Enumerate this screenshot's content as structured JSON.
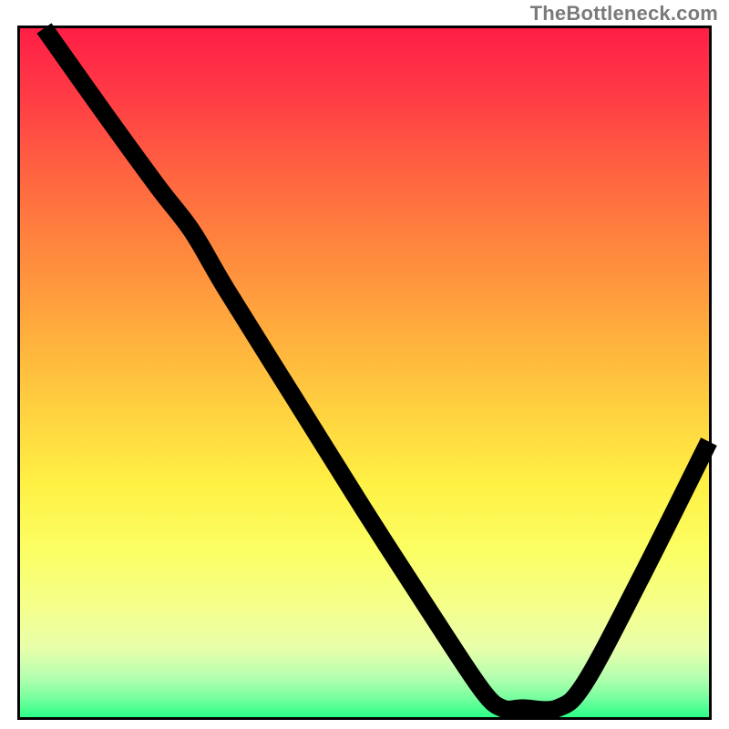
{
  "watermark": "TheBottleneck.com",
  "chart_data": {
    "type": "line",
    "title": "",
    "xlabel": "",
    "ylabel": "",
    "xlim": [
      0,
      100
    ],
    "ylim": [
      0,
      100
    ],
    "curve": [
      {
        "x": 3.5,
        "y": 100
      },
      {
        "x": 12,
        "y": 88
      },
      {
        "x": 20,
        "y": 77
      },
      {
        "x": 25,
        "y": 70.5
      },
      {
        "x": 30,
        "y": 62
      },
      {
        "x": 40,
        "y": 46
      },
      {
        "x": 50,
        "y": 30
      },
      {
        "x": 60,
        "y": 14.5
      },
      {
        "x": 67,
        "y": 4
      },
      {
        "x": 70,
        "y": 1.3
      },
      {
        "x": 73,
        "y": 1.3
      },
      {
        "x": 78,
        "y": 1.3
      },
      {
        "x": 82,
        "y": 5
      },
      {
        "x": 90,
        "y": 20
      },
      {
        "x": 100,
        "y": 40
      }
    ],
    "optimal_marker": {
      "x_start": 70,
      "x_end": 78,
      "y": 1.3,
      "color": "#dd6d6e"
    },
    "background_gradient": {
      "top": "#ff1e46",
      "mid": "#fff044",
      "bottom": "#2bff88"
    }
  }
}
